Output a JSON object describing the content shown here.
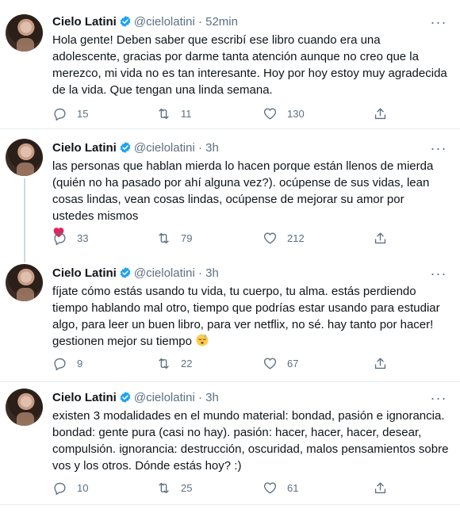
{
  "tweets": [
    {
      "name": "Cielo Latini",
      "handle": "@cielolatini",
      "dot": "·",
      "time": "52min",
      "more": "···",
      "text": "Hola gente! Deben saber que escribí ese libro cuando era una adolescente, gracias por darme tanta atención aunque no creo que la merezco, mi vida no es tan interesante. Hoy por hoy estoy muy agradecida de la vida. Que tengan una linda semana.",
      "replies": "15",
      "retweets": "11",
      "likes": "130"
    },
    {
      "name": "Cielo Latini",
      "handle": "@cielolatini",
      "dot": "·",
      "time": "3h",
      "more": "···",
      "text": "las personas que hablan mierda lo hacen porque están llenos de mierda (quién no ha pasado por ahí alguna vez?). ocúpense de sus vidas, lean cosas lindas, vean cosas lindas, ocúpense de mejorar su amor por ustedes mismos",
      "emoji": "red-heart",
      "replies": "33",
      "retweets": "79",
      "likes": "212"
    },
    {
      "name": "Cielo Latini",
      "handle": "@cielolatini",
      "dot": "·",
      "time": "3h",
      "more": "···",
      "text": "fíjate cómo estás usando tu vida, tu cuerpo, tu alma. estás perdiendo tiempo hablando mal otro, tiempo que podrías estar usando para estudiar algo, para leer un buen libro, para ver netflix, no sé. hay tanto por hacer! gestionen mejor su tiempo",
      "emoji": "sleeping-face",
      "replies": "9",
      "retweets": "22",
      "likes": "67"
    },
    {
      "name": "Cielo Latini",
      "handle": "@cielolatini",
      "dot": "·",
      "time": "3h",
      "more": "···",
      "text": "existen 3 modalidades en el mundo material: bondad, pasión e ignorancia. bondad: gente pura (casi no hay). pasión: hacer, hacer, hacer, desear, compulsión. ignorancia: destrucción, oscuridad, malos pensamientos sobre vos y los otros. Dónde estás hoy? :)",
      "replies": "10",
      "retweets": "25",
      "likes": "61"
    }
  ],
  "colors": {
    "text": "#0f1419",
    "secondary": "#5b7083",
    "verified": "#1da1f2",
    "divider": "#e6ecf0",
    "thread_line": "#cfd9de",
    "heart": "#e0245e"
  }
}
